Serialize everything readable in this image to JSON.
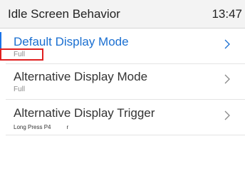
{
  "header": {
    "title": "Idle Screen Behavior",
    "time": "13:47"
  },
  "items": [
    {
      "label": "Default Display Mode",
      "value": "Full"
    },
    {
      "label": "Alternative Display Mode",
      "value": "Full"
    },
    {
      "label": "Alternative Display Trigger",
      "value": "Long Press P4",
      "extra": "r"
    }
  ],
  "colors": {
    "accent": "#1a73e8",
    "highlight": "#e02020",
    "header_bg": "#f3f3f3"
  }
}
